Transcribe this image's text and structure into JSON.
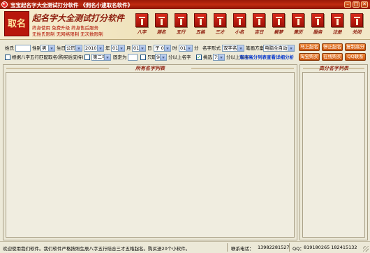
{
  "window": {
    "title": "宝宝起名字大全测试打分软件 《佣名小逮取名软件》",
    "min_glyph": "–",
    "max_glyph": "□",
    "close_glyph": "✕"
  },
  "banner": {
    "logo_text": "取名",
    "title": "起名字大全测试打分软件",
    "slogan_line1": "终身使用  免费升级  终身售后服务",
    "slogan_line2": "无姓氏限制  无网络限制  无次数限制",
    "nav_items": [
      {
        "label": "八字",
        "icon": "bazi-tile-icon"
      },
      {
        "label": "测名",
        "icon": "ceming-tile-icon"
      },
      {
        "label": "五行",
        "icon": "wuxing-tile-icon"
      },
      {
        "label": "五格",
        "icon": "wuge-tile-icon"
      },
      {
        "label": "三才",
        "icon": "sancai-tile-icon"
      },
      {
        "label": "小名",
        "icon": "xiaoming-tile-icon"
      },
      {
        "label": "吉日",
        "icon": "jiri-tile-icon"
      },
      {
        "label": "解梦",
        "icon": "jiemeng-tile-icon"
      },
      {
        "label": "黄历",
        "icon": "huangli-tile-icon"
      },
      {
        "label": "服务",
        "icon": "fuwu-tile-icon"
      },
      {
        "label": "注册",
        "icon": "zhuce-tile-icon"
      },
      {
        "label": "关闭",
        "icon": "guanbi-tile-icon"
      }
    ]
  },
  "form": {
    "surname_label": "姓氏",
    "surname_value": "",
    "gender_label": "性别",
    "gender_value": "男",
    "birthday_label": "生日",
    "calendar_value": "公历",
    "year_value": "2010",
    "year_label": "年",
    "month_value": "01",
    "month_label": "月",
    "day_value": "01",
    "day_label": "日",
    "hour_value": "子 0",
    "hour_label": "时",
    "minute_value": "01",
    "minute_label": "分",
    "name_form_label": "名字形式",
    "name_form_value": "双字名",
    "scheme_label": "笔画方案",
    "scheme_value": "电脑全自动",
    "bazi_check_label": "根据八字五行匹配取名(购买后支持)",
    "bazi_checked": false,
    "second_char_value": "第二字",
    "fixed_label": "固定为",
    "fixed_value": "",
    "only_take_label": "只取",
    "only_take_value": "90",
    "above_names_label": "分以上名字",
    "filter_label": "挑选",
    "filter_checked": true,
    "filter_value": "75",
    "filter_suffix": "分以上名字",
    "filter_link": "双击高分列表查看详细分析"
  },
  "buttons": {
    "start": "马上起名",
    "stop": "停止起名",
    "copy": "复制高分",
    "taobao": "淘宝购买",
    "online": "在线购买",
    "qq": "QQ联系"
  },
  "panels": {
    "all_names": "所有名字列表",
    "high_names": "高分名字列表"
  },
  "status": {
    "message": "欢迎使用我们软件。我们软件严格按照生辰八字五行结合三才五格起名。购买送20个小软件。",
    "contact_label": "联系电话：",
    "phone": "13982281527",
    "qq_label": "QQ：",
    "qq": "819180265 182415132"
  }
}
